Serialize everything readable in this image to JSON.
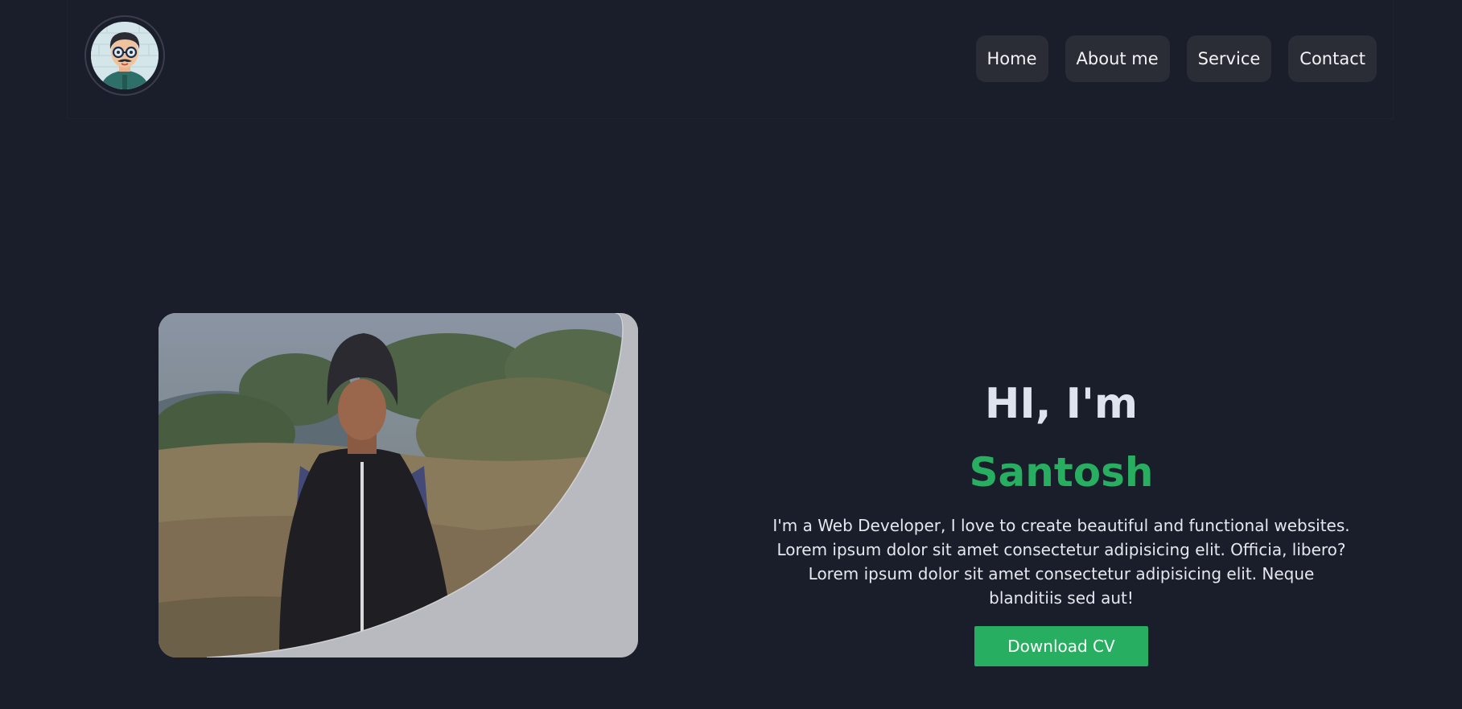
{
  "header": {
    "nav": [
      {
        "label": "Home"
      },
      {
        "label": "About me"
      },
      {
        "label": "Service"
      },
      {
        "label": "Contact"
      }
    ]
  },
  "hero": {
    "greeting": "HI, I'm",
    "name": "Santosh",
    "description": "I'm a Web Developer, I love to create beautiful and functional websites. Lorem ipsum dolor sit amet consectetur adipisicing elit. Officia, libero? Lorem ipsum dolor sit amet consectetur adipisicing elit. Neque blanditiis sed aut!",
    "button_label": "Download CV"
  },
  "colors": {
    "background": "#1a1d2a",
    "accent": "#27ae60",
    "nav_button": "#2a2d35"
  },
  "icons": {
    "logo": "cartoon-avatar-icon"
  }
}
